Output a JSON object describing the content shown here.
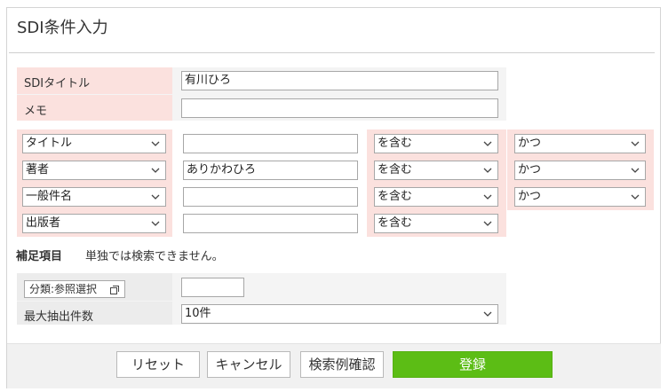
{
  "dialog": {
    "title": "SDI条件入力"
  },
  "top_fields": {
    "sdi_title_label": "SDIタイトル",
    "sdi_title_value": "有川ひろ",
    "memo_label": "メモ",
    "memo_value": ""
  },
  "criteria": [
    {
      "field": "タイトル",
      "value": "",
      "match": "を含む",
      "logic": "かつ"
    },
    {
      "field": "著者",
      "value": "ありかわひろ",
      "match": "を含む",
      "logic": "かつ"
    },
    {
      "field": "一般件名",
      "value": "",
      "match": "を含む",
      "logic": "かつ"
    },
    {
      "field": "出版者",
      "value": "",
      "match": "を含む",
      "logic": ""
    }
  ],
  "supplement": {
    "heading": "補足項目",
    "note": "単独では検索できません。",
    "category_button_label": "分類:参照選択",
    "category_value": "",
    "max_count_label": "最大抽出件数",
    "max_count_value": "10件"
  },
  "footer": {
    "reset_label": "リセット",
    "cancel_label": "キャンセル",
    "example_label": "検索例確認",
    "register_label": "登録"
  },
  "colors": {
    "label_bg": "#fbe1de",
    "primary_button": "#5cbd15"
  },
  "icons": {
    "dropdown": "chevron-down-icon",
    "external": "external-window-icon"
  }
}
